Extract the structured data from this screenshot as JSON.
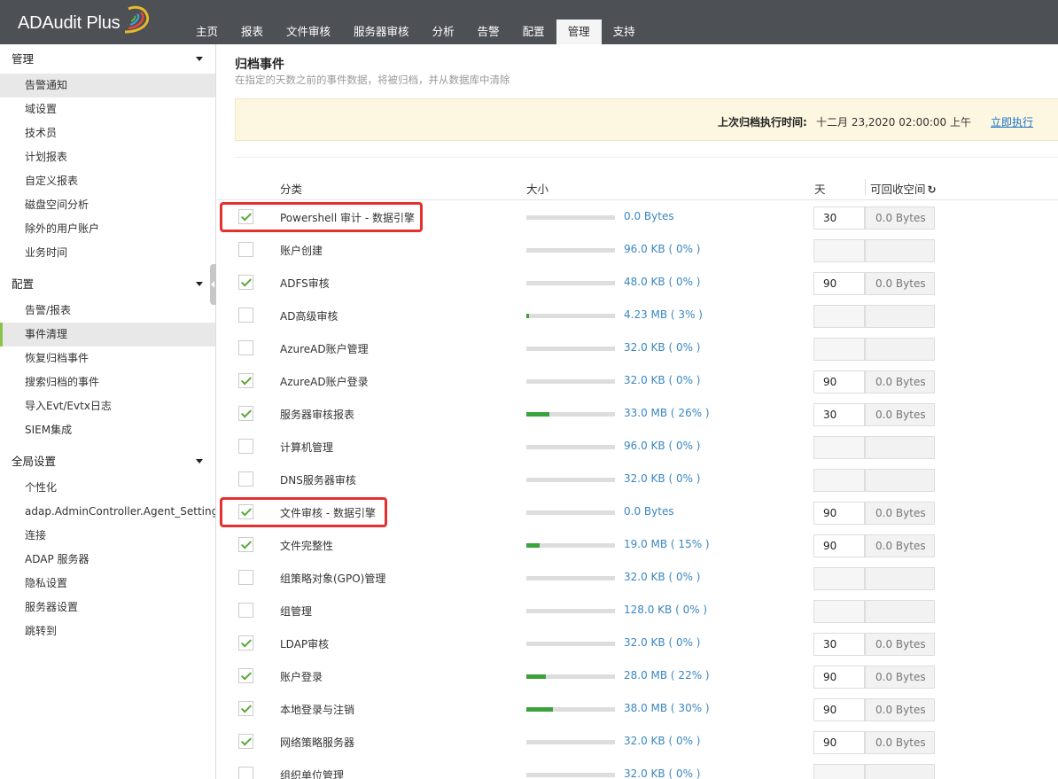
{
  "app": {
    "title": "ADAudit Plus",
    "nav": [
      "主页",
      "报表",
      "文件审核",
      "服务器审核",
      "分析",
      "告警",
      "配置",
      "管理",
      "支持"
    ],
    "active_nav": "管理"
  },
  "sidebar": {
    "sections": [
      {
        "label": "管理",
        "items": [
          "告警通知",
          "域设置",
          "技术员",
          "计划报表",
          "自定义报表",
          "磁盘空间分析",
          "除外的用户账户",
          "业务时间"
        ]
      },
      {
        "label": "配置",
        "items": [
          "告警/报表",
          "事件清理",
          "恢复归档事件",
          "搜索归档的事件",
          "导入Evt/Evtx日志",
          "SIEM集成"
        ]
      },
      {
        "label": "全局设置",
        "items": [
          "个性化",
          "adap.AdminController.Agent_Settings",
          "连接",
          "ADAP 服务器",
          "隐私设置",
          "服务器设置",
          "跳转到"
        ]
      }
    ]
  },
  "main": {
    "title": "归档事件",
    "subtitle": "在指定的天数之前的事件数据，将被归档，并从数据库中清除",
    "banner": {
      "label": "上次归档执行时间:",
      "value": "十二月 23,2020 02:00:00 上午",
      "link": "立即执行"
    },
    "columns": {
      "category": "分类",
      "size": "大小",
      "days": "天",
      "reclaim": "可回收空间"
    },
    "rows": [
      {
        "checked": true,
        "category": "Powershell 审计 - 数据引擎",
        "size": "0.0 Bytes",
        "percent": 0,
        "days": "30",
        "reclaim": "0.0 Bytes"
      },
      {
        "checked": false,
        "category": "账户创建",
        "size": "96.0 KB ( 0% )",
        "percent": 0,
        "days": "",
        "reclaim": ""
      },
      {
        "checked": true,
        "category": "ADFS审核",
        "size": "48.0 KB ( 0% )",
        "percent": 0,
        "days": "90",
        "reclaim": "0.0 Bytes"
      },
      {
        "checked": false,
        "category": "AD高级审核",
        "size": "4.23 MB ( 3% )",
        "percent": 3,
        "days": "",
        "reclaim": ""
      },
      {
        "checked": false,
        "category": "AzureAD账户管理",
        "size": "32.0 KB ( 0% )",
        "percent": 0,
        "days": "",
        "reclaim": ""
      },
      {
        "checked": true,
        "category": "AzureAD账户登录",
        "size": "32.0 KB ( 0% )",
        "percent": 0,
        "days": "90",
        "reclaim": "0.0 Bytes"
      },
      {
        "checked": true,
        "category": "服务器审核报表",
        "size": "33.0 MB ( 26% )",
        "percent": 26,
        "days": "30",
        "reclaim": "0.0 Bytes"
      },
      {
        "checked": false,
        "category": "计算机管理",
        "size": "96.0 KB ( 0% )",
        "percent": 0,
        "days": "",
        "reclaim": ""
      },
      {
        "checked": false,
        "category": "DNS服务器审核",
        "size": "32.0 KB ( 0% )",
        "percent": 0,
        "days": "",
        "reclaim": ""
      },
      {
        "checked": true,
        "category": "文件审核 - 数据引擎",
        "size": "0.0 Bytes",
        "percent": 0,
        "days": "90",
        "reclaim": "0.0 Bytes"
      },
      {
        "checked": true,
        "category": "文件完整性",
        "size": "19.0 MB ( 15% )",
        "percent": 15,
        "days": "90",
        "reclaim": "0.0 Bytes"
      },
      {
        "checked": false,
        "category": "组策略对象(GPO)管理",
        "size": "32.0 KB ( 0% )",
        "percent": 0,
        "days": "",
        "reclaim": ""
      },
      {
        "checked": false,
        "category": "组管理",
        "size": "128.0 KB ( 0% )",
        "percent": 0,
        "days": "",
        "reclaim": ""
      },
      {
        "checked": true,
        "category": "LDAP审核",
        "size": "32.0 KB ( 0% )",
        "percent": 0,
        "days": "30",
        "reclaim": "0.0 Bytes"
      },
      {
        "checked": true,
        "category": "账户登录",
        "size": "28.0 MB ( 22% )",
        "percent": 22,
        "days": "90",
        "reclaim": "0.0 Bytes"
      },
      {
        "checked": true,
        "category": "本地登录与注销",
        "size": "38.0 MB ( 30% )",
        "percent": 30,
        "days": "90",
        "reclaim": "0.0 Bytes"
      },
      {
        "checked": true,
        "category": "网络策略服务器",
        "size": "32.0 KB ( 0% )",
        "percent": 0,
        "days": "90",
        "reclaim": "0.0 Bytes"
      },
      {
        "checked": false,
        "category": "组织单位管理",
        "size": "32.0 KB ( 0% )",
        "percent": 0,
        "days": "",
        "reclaim": ""
      }
    ],
    "highlighted_rows": [
      0,
      9
    ]
  },
  "colors": {
    "topbar": "#4d5055",
    "link": "#1a73c8",
    "bar_fill": "#3ca23c",
    "highlight": "#e53030",
    "banner": "#fdf7e1"
  }
}
